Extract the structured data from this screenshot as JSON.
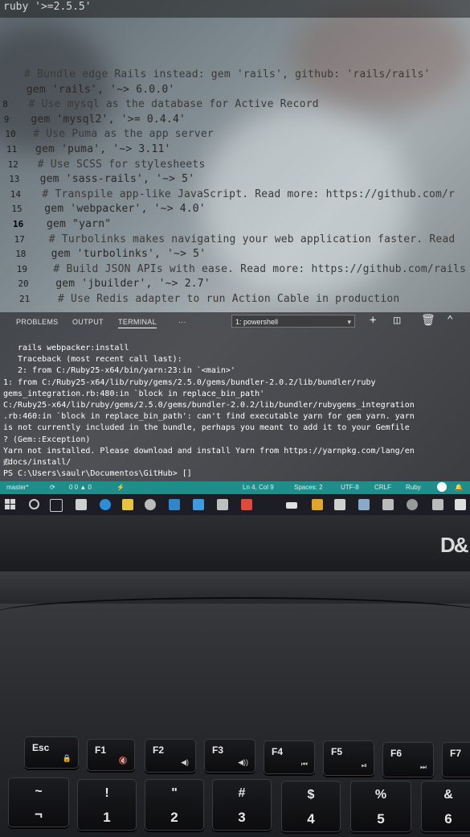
{
  "editor": {
    "tab_line": "ruby '>=2.5.5'",
    "lines": [
      {
        "num": "",
        "text": "# Bundle edge Rails instead: gem 'rails', github: 'rails/rails'",
        "comment": true
      },
      {
        "num": "",
        "text": "gem 'rails', '~> 6.0.0'",
        "comment": false
      },
      {
        "num": "8",
        "text": "# Use mysql as the database for Active Record",
        "comment": true
      },
      {
        "num": "9",
        "text": "gem 'mysql2', '>= 0.4.4'",
        "comment": false
      },
      {
        "num": "10",
        "text": "# Use Puma as the app server",
        "comment": true
      },
      {
        "num": "11",
        "text": "gem 'puma', '~> 3.11'",
        "comment": false
      },
      {
        "num": "12",
        "text": "# Use SCSS for stylesheets",
        "comment": true
      },
      {
        "num": "13",
        "text": "gem 'sass-rails', '~> 5'",
        "comment": false
      },
      {
        "num": "14",
        "text": "# Transpile app-like JavaScript. Read more: https://github.com/r",
        "comment": true
      },
      {
        "num": "15",
        "text": "gem 'webpacker', '~> 4.0'",
        "comment": false
      },
      {
        "num": "16",
        "text": "gem \"yarn\"",
        "comment": false,
        "active": true
      },
      {
        "num": "17",
        "text": "# Turbolinks makes navigating your web application faster. Read",
        "comment": true
      },
      {
        "num": "18",
        "text": "gem 'turbolinks', '~> 5'",
        "comment": false
      },
      {
        "num": "19",
        "text": "# Build JSON APIs with ease. Read more: https://github.com/rails",
        "comment": true
      },
      {
        "num": "20",
        "text": "gem 'jbuilder', '~> 2.7'",
        "comment": false
      },
      {
        "num": "21",
        "text": "# Use Redis adapter to run Action Cable in production",
        "comment": true
      }
    ]
  },
  "panel": {
    "tabs": [
      "PROBLEMS",
      "OUTPUT",
      "TERMINAL",
      "···"
    ],
    "shell": "1: powershell",
    "terminal_lines": [
      "     rails webpacker:install",
      "Traceback (most recent call last):",
      "        2: from C:/Ruby25-x64/bin/yarn:23:in `<main>'",
      "        1: from C:/Ruby25-x64/lib/ruby/gems/2.5.0/gems/bundler-2.0.2/lib/bundler/ruby",
      "gems_integration.rb:480:in `block in replace_bin_path'",
      "C:/Ruby25-x64/lib/ruby/gems/2.5.0/gems/bundler-2.0.2/lib/bundler/rubygems_integration",
      ".rb:460:in `block in replace_bin_path': can't find executable yarn for gem yarn. yarn",
      " is not currently included in the bundle, perhaps you meant to add it to your Gemfile",
      "? (Gem::Exception)",
      "Yarn not installed. Please download and install Yarn from https://yarnpkg.com/lang/en",
      "/docs/install/",
      "PS C:\\Users\\saulr\\Documentos\\GitHub> []"
    ]
  },
  "statusbar": {
    "branch": "master*",
    "problems": "0 0 ▲ 0",
    "cursor": "Ln 4, Col 9",
    "spaces": "Spaces: 2",
    "encoding": "UTF-8",
    "eol": "CRLF",
    "language": "Ruby"
  },
  "brand": "D&",
  "keyboard": {
    "fn_row": [
      {
        "label": "Esc",
        "sub": "🔒"
      },
      {
        "label": "F1",
        "sub": "🔇"
      },
      {
        "label": "F2",
        "sub": "◀)"
      },
      {
        "label": "F3",
        "sub": "◀))"
      },
      {
        "label": "F4",
        "sub": "⏮"
      },
      {
        "label": "F5",
        "sub": "⏯"
      },
      {
        "label": "F6",
        "sub": "⏭"
      },
      {
        "label": "F7",
        "sub": ""
      }
    ],
    "num_row": [
      {
        "top": "~",
        "bottom": "¬"
      },
      {
        "top": "!",
        "bottom": "1"
      },
      {
        "top": "\"",
        "bottom": "2"
      },
      {
        "top": "#",
        "bottom": "3"
      },
      {
        "top": "$",
        "bottom": "4"
      },
      {
        "top": "%",
        "bottom": "5"
      },
      {
        "top": "&",
        "bottom": "6"
      }
    ]
  },
  "colors": {
    "statusbar": "#1f8e8b",
    "taskbar": "#1c1d25",
    "terminal_text": "#ffffff"
  }
}
